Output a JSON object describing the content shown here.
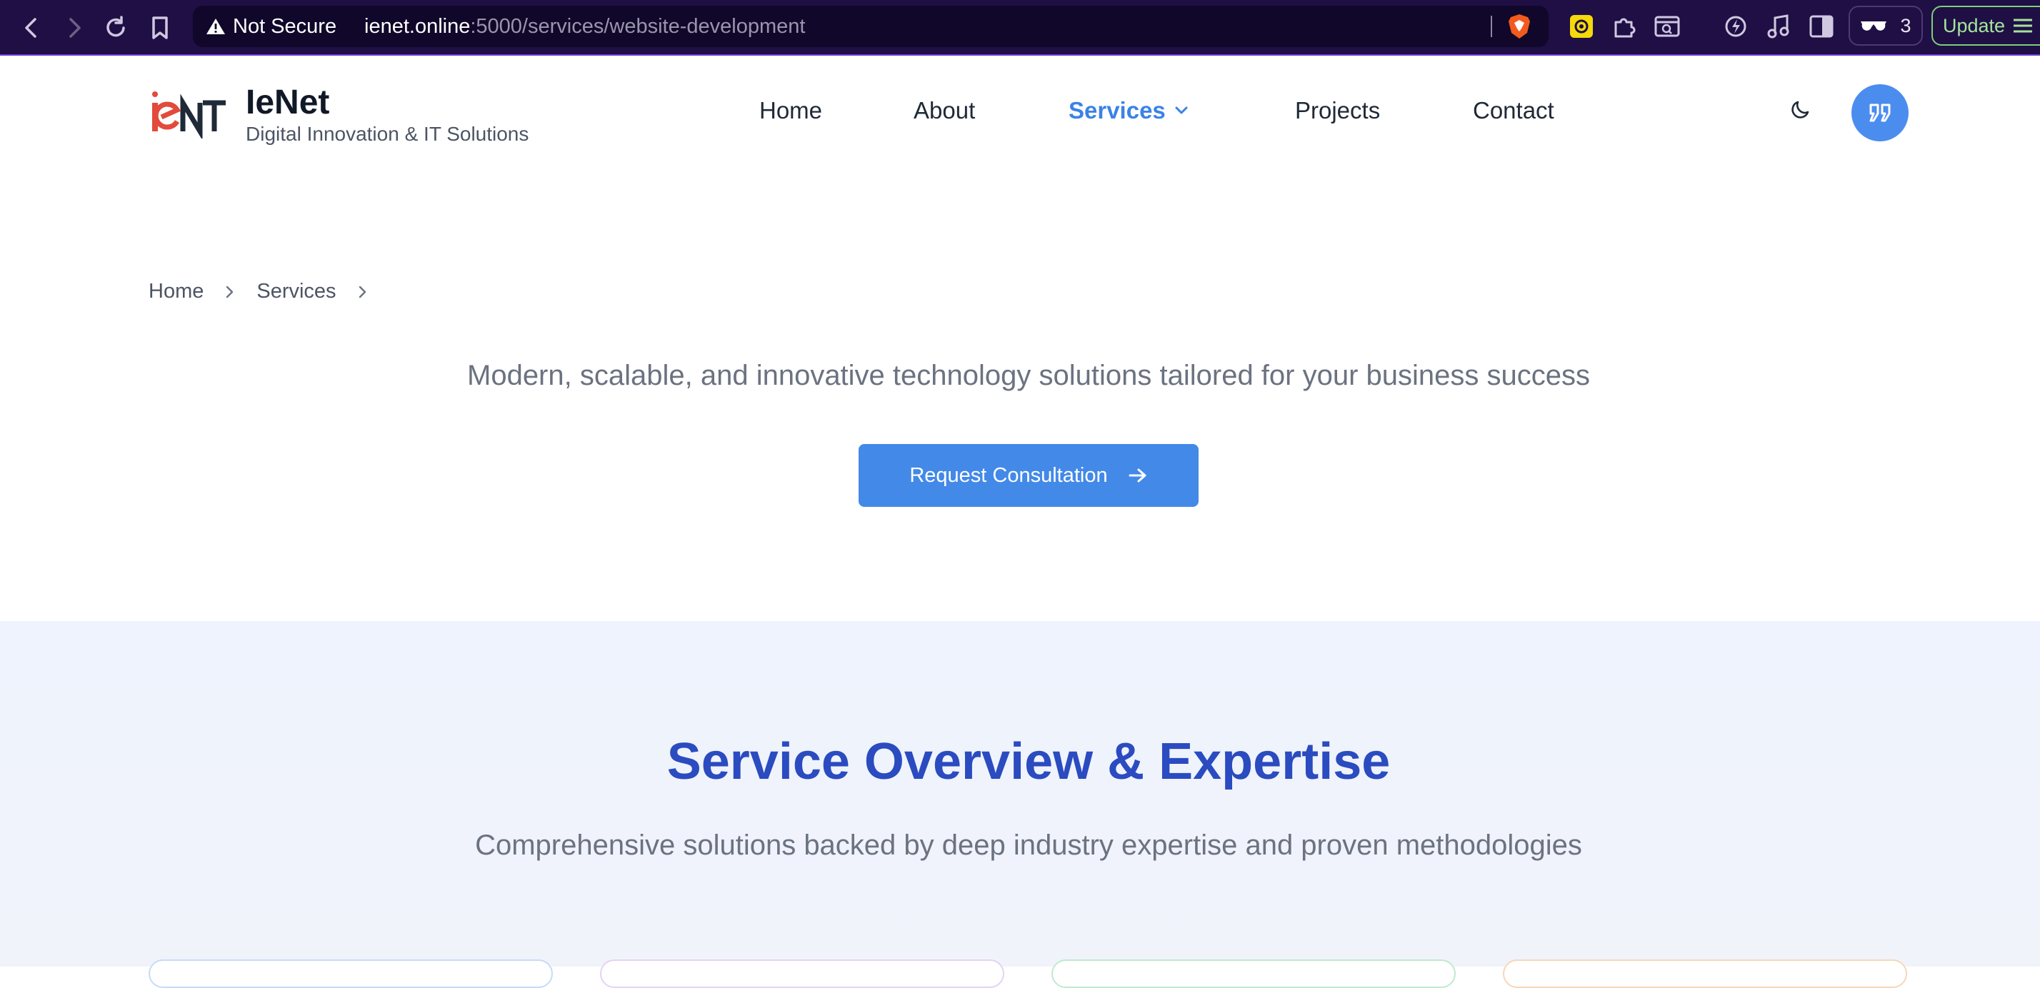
{
  "browser": {
    "not_secure_label": "Not Secure",
    "url_host": "ienet.online",
    "url_path": ":5000/services/website-development",
    "extension_count": "3",
    "update_label": "Update"
  },
  "header": {
    "brand_name": "IeNet",
    "brand_tagline": "Digital Innovation & IT Solutions",
    "nav": {
      "home": "Home",
      "about": "About",
      "services": "Services",
      "projects": "Projects",
      "contact": "Contact"
    },
    "accent_color": "#3b82e6"
  },
  "hero": {
    "breadcrumb": {
      "home": "Home",
      "services": "Services"
    },
    "subtitle": "Modern, scalable, and innovative technology solutions tailored for your business success",
    "cta_label": "Request Consultation"
  },
  "overview": {
    "title": "Service Overview & Expertise",
    "subtitle": "Comprehensive solutions backed by deep industry expertise and proven methodologies"
  }
}
